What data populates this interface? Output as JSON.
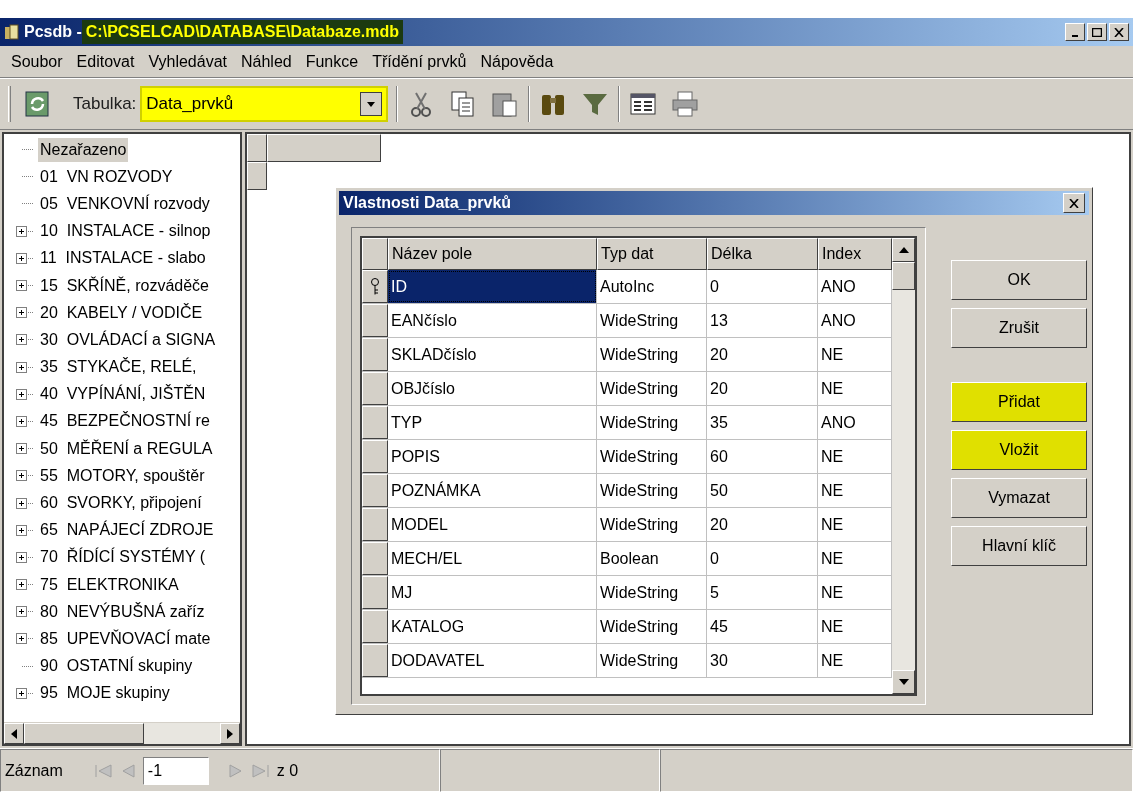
{
  "window": {
    "app": "Pcsdb",
    "separator": " - ",
    "path": "C:\\PCSELCAD\\DATABASE\\Databaze.mdb",
    "path_highlighted": true
  },
  "menu": [
    "Soubor",
    "Editovat",
    "Vyhledávat",
    "Náhled",
    "Funkce",
    "Třídění prvků",
    "Nápověda"
  ],
  "toolbar": {
    "table_label": "Tabulka:",
    "table_value": "Data_prvků",
    "table_highlighted": true
  },
  "tree": [
    {
      "label": "Nezařazeno",
      "expandable": false,
      "selected": true
    },
    {
      "label": "01  VN ROZVODY",
      "expandable": false,
      "selected": false
    },
    {
      "label": "05  VENKOVNÍ rozvody",
      "expandable": false,
      "selected": false
    },
    {
      "label": "10  INSTALACE - silnop",
      "expandable": true,
      "selected": false
    },
    {
      "label": "11  INSTALACE - slabo",
      "expandable": true,
      "selected": false
    },
    {
      "label": "15  SKŘÍNĚ, rozváděče",
      "expandable": true,
      "selected": false
    },
    {
      "label": "20  KABELY / VODIČE",
      "expandable": true,
      "selected": false
    },
    {
      "label": "30  OVLÁDACÍ a SIGNA",
      "expandable": true,
      "selected": false
    },
    {
      "label": "35  STYKAČE, RELÉ,",
      "expandable": true,
      "selected": false
    },
    {
      "label": "40  VYPÍNÁNÍ, JIŠTĚN",
      "expandable": true,
      "selected": false
    },
    {
      "label": "45  BEZPEČNOSTNÍ re",
      "expandable": true,
      "selected": false
    },
    {
      "label": "50  MĚŘENÍ a REGULA",
      "expandable": true,
      "selected": false
    },
    {
      "label": "55  MOTORY, spouštěr",
      "expandable": true,
      "selected": false
    },
    {
      "label": "60  SVORKY, připojení",
      "expandable": true,
      "selected": false
    },
    {
      "label": "65  NAPÁJECÍ ZDROJE",
      "expandable": true,
      "selected": false
    },
    {
      "label": "70  ŘÍDÍCÍ SYSTÉMY (",
      "expandable": true,
      "selected": false
    },
    {
      "label": "75  ELEKTRONIKA",
      "expandable": true,
      "selected": false
    },
    {
      "label": "80  NEVÝBUŠNÁ zaříz",
      "expandable": true,
      "selected": false
    },
    {
      "label": "85  UPEVŇOVACÍ mate",
      "expandable": true,
      "selected": false
    },
    {
      "label": "90  OSTATNÍ skupiny",
      "expandable": false,
      "selected": false
    },
    {
      "label": "95  MOJE skupiny",
      "expandable": true,
      "selected": false
    }
  ],
  "dialog": {
    "title": "Vlastnosti Data_prvků",
    "columns": [
      "Název pole",
      "Typ dat",
      "Délka",
      "Index"
    ],
    "rows": [
      {
        "cells": [
          "ID",
          "AutoInc",
          "0",
          "ANO"
        ],
        "primary_key": true,
        "selected": true
      },
      {
        "cells": [
          "EANčíslo",
          "WideString",
          "13",
          "ANO"
        ],
        "primary_key": false,
        "selected": false
      },
      {
        "cells": [
          "SKLADčíslo",
          "WideString",
          "20",
          "NE"
        ],
        "primary_key": false,
        "selected": false
      },
      {
        "cells": [
          "OBJčíslo",
          "WideString",
          "20",
          "NE"
        ],
        "primary_key": false,
        "selected": false
      },
      {
        "cells": [
          "TYP",
          "WideString",
          "35",
          "ANO"
        ],
        "primary_key": false,
        "selected": false
      },
      {
        "cells": [
          "POPIS",
          "WideString",
          "60",
          "NE"
        ],
        "primary_key": false,
        "selected": false
      },
      {
        "cells": [
          "POZNÁMKA",
          "WideString",
          "50",
          "NE"
        ],
        "primary_key": false,
        "selected": false
      },
      {
        "cells": [
          "MODEL",
          "WideString",
          "20",
          "NE"
        ],
        "primary_key": false,
        "selected": false
      },
      {
        "cells": [
          "MECH/EL",
          "Boolean",
          "0",
          "NE"
        ],
        "primary_key": false,
        "selected": false
      },
      {
        "cells": [
          "MJ",
          "WideString",
          "5",
          "NE"
        ],
        "primary_key": false,
        "selected": false
      },
      {
        "cells": [
          "KATALOG",
          "WideString",
          "45",
          "NE"
        ],
        "primary_key": false,
        "selected": false
      },
      {
        "cells": [
          "DODAVATEL",
          "WideString",
          "30",
          "NE"
        ],
        "primary_key": false,
        "selected": false
      }
    ],
    "button_groups": [
      [
        {
          "label": "OK",
          "highlighted": false
        },
        {
          "label": "Zrušit",
          "highlighted": false
        }
      ],
      [
        {
          "label": "Přidat",
          "highlighted": true
        },
        {
          "label": "Vložit",
          "highlighted": true
        },
        {
          "label": "Vymazat",
          "highlighted": false
        },
        {
          "label": "Hlavní klíč",
          "highlighted": false
        }
      ]
    ]
  },
  "status_bar": {
    "label": "Záznam",
    "record": "-1",
    "total": "z 0"
  }
}
